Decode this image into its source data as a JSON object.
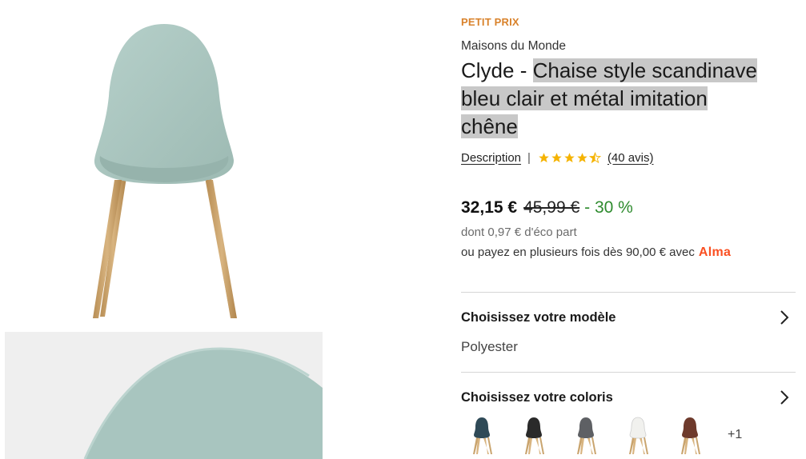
{
  "product": {
    "badge": "PETIT PRIX",
    "brand": "Maisons du Monde",
    "title_prefix": "Clyde - ",
    "title_highlight_1": "Chaise style scandinave",
    "title_highlight_2": "bleu clair et métal imitation",
    "title_highlight_3": "chêne",
    "description_link": "Description",
    "separator": "|",
    "rating": 4.5,
    "reviews_link": "(40 avis)",
    "star_color": "#f5b301"
  },
  "pricing": {
    "current": "32,15 €",
    "old": "45,99 €",
    "discount": "- 30 %",
    "eco_part": "dont 0,97 € d'éco part",
    "installments": "ou payez en plusieurs fois dès 90,00 € avec",
    "alma": "Alma",
    "discount_color": "#2e8b2e",
    "alma_color": "#fa5022"
  },
  "options": {
    "model_title": "Choisissez votre modèle",
    "model_value": "Polyester",
    "color_title": "Choisissez votre coloris",
    "more_colors": "+1",
    "swatches": [
      {
        "name": "dark-teal",
        "seat": "#2f4a57"
      },
      {
        "name": "black",
        "seat": "#2a2a2a"
      },
      {
        "name": "grey",
        "seat": "#5e6064"
      },
      {
        "name": "white",
        "seat": "#f1f1ee"
      },
      {
        "name": "brown",
        "seat": "#6e3a2c"
      }
    ]
  },
  "colors": {
    "badge": "#d9822b",
    "chair_fabric": "#a9c6c0",
    "chair_legs": "#c9a46e",
    "highlight": "#c8c8c8"
  }
}
